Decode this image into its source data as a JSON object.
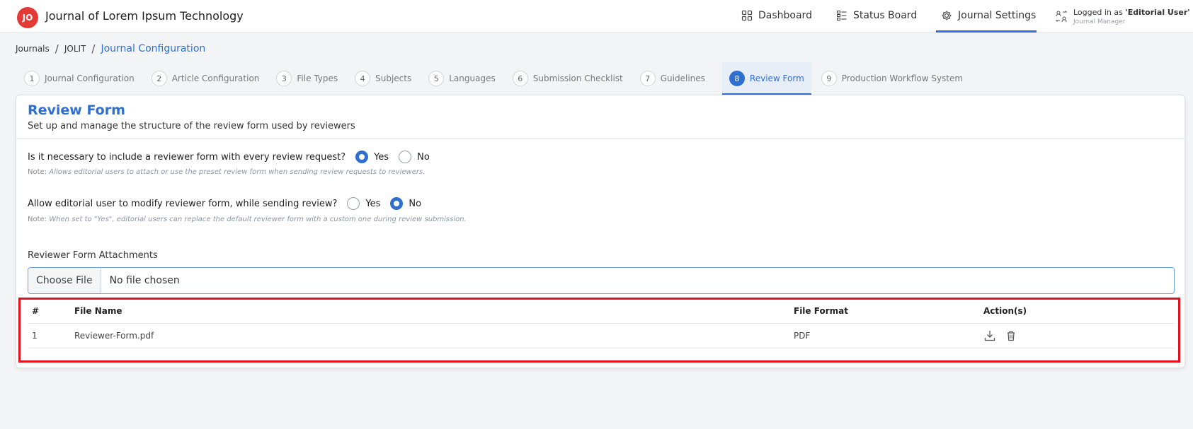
{
  "header": {
    "logo_text": "JO",
    "app_title": "Journal of Lorem Ipsum Technology",
    "nav": [
      {
        "label": "Dashboard",
        "icon": "grid-icon"
      },
      {
        "label": "Status Board",
        "icon": "list-icon"
      },
      {
        "label": "Journal Settings",
        "icon": "gear-icon"
      }
    ],
    "user": {
      "prefix": "Logged in as ",
      "name": "'Editorial User'",
      "role": "Journal Manager"
    },
    "accent_color": "#2f6fd1"
  },
  "breadcrumb": [
    "Journals",
    "JOLIT",
    "Journal Configuration"
  ],
  "steps": [
    {
      "num": "1",
      "label": "Journal Configuration"
    },
    {
      "num": "2",
      "label": "Article Configuration"
    },
    {
      "num": "3",
      "label": "File Types"
    },
    {
      "num": "4",
      "label": "Subjects"
    },
    {
      "num": "5",
      "label": "Languages"
    },
    {
      "num": "6",
      "label": "Submission Checklist"
    },
    {
      "num": "7",
      "label": "Guidelines"
    },
    {
      "num": "8",
      "label": "Review Form",
      "active": true
    },
    {
      "num": "9",
      "label": "Production Workflow System"
    }
  ],
  "form": {
    "title": "Review Form",
    "subtitle": "Set up and manage the structure of the review form used by reviewers",
    "q1": {
      "text": "Is it necessary to include a reviewer form with every review request?",
      "yes": "Yes",
      "no": "No",
      "selected": "Yes",
      "note_label": "Note:",
      "note": "Allows editorial users to attach or use the preset review form when sending review requests to reviewers."
    },
    "q2": {
      "text": "Allow editorial user to modify reviewer form, while sending review?",
      "yes": "Yes",
      "no": "No",
      "selected": "No",
      "note_label": "Note:",
      "note": "When set to \"Yes\", editorial users can replace the default reviewer form with a custom one during review submission."
    },
    "attachments_label": "Reviewer Form Attachments",
    "file_button": "Choose File",
    "file_status": "No file chosen"
  },
  "table": {
    "headers": [
      "#",
      "File Name",
      "File Format",
      "Action(s)"
    ],
    "rows": [
      {
        "idx": "1",
        "name": "Reviewer-Form.pdf",
        "format": "PDF"
      }
    ]
  }
}
